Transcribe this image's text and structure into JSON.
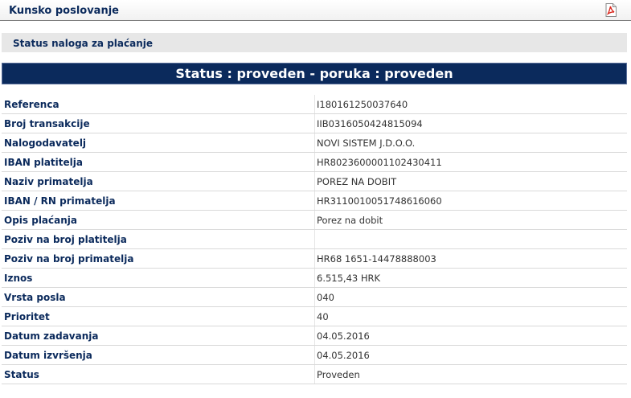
{
  "header": {
    "title": "Kunsko poslovanje",
    "pdf_icon": "pdf-icon"
  },
  "section": {
    "title": "Status naloga za plaćanje"
  },
  "status_banner": {
    "text": "Status : proveden - poruka : proveden"
  },
  "details": [
    {
      "label": "Referenca",
      "value": "I180161250037640"
    },
    {
      "label": "Broj transakcije",
      "value": "IIB0316050424815094"
    },
    {
      "label": "Nalogodavatelj",
      "value": "NOVI SISTEM J.D.O.O."
    },
    {
      "label": "IBAN platitelja",
      "value": "HR8023600001102430411"
    },
    {
      "label": "Naziv primatelja",
      "value": "POREZ NA DOBIT"
    },
    {
      "label": "IBAN / RN primatelja",
      "value": "HR3110010051748616060"
    },
    {
      "label": "Opis plaćanja",
      "value": "Porez na dobit"
    },
    {
      "label": "Poziv na broj platitelja",
      "value": ""
    },
    {
      "label": "Poziv na broj primatelja",
      "value": "HR68 1651-14478888003"
    },
    {
      "label": "Iznos",
      "value": "6.515,43 HRK"
    },
    {
      "label": "Vrsta posla",
      "value": "040"
    },
    {
      "label": "Prioritet",
      "value": "40"
    },
    {
      "label": "Datum zadavanja",
      "value": "04.05.2016"
    },
    {
      "label": "Datum izvršenja",
      "value": "04.05.2016"
    },
    {
      "label": "Status",
      "value": "Proveden"
    }
  ],
  "colors": {
    "banner_bg": "#0b2a5c",
    "label_text": "#0b2a5c",
    "section_bg": "#e7e7e7",
    "pdf_red": "#d9261c"
  }
}
